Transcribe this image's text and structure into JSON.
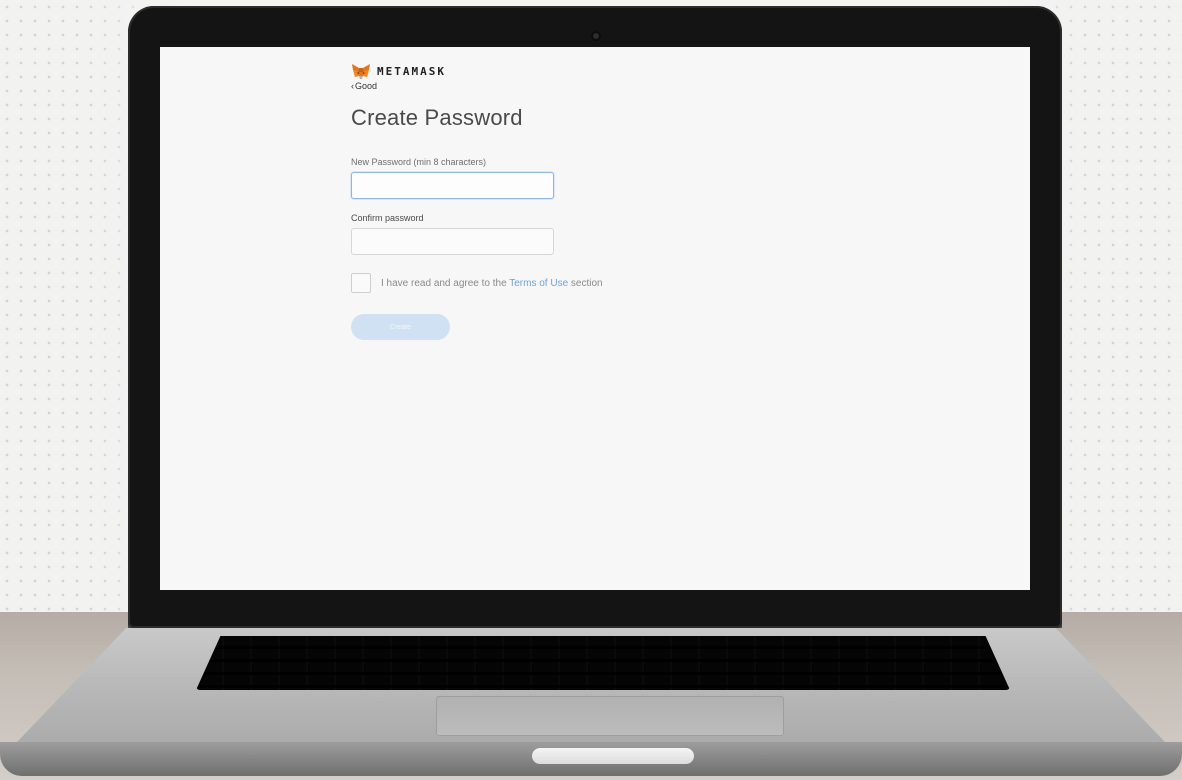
{
  "brand": {
    "name": "METAMASK",
    "icon": "metamask-fox-icon"
  },
  "nav": {
    "back_label": "Good",
    "back_icon": "chevron-left-icon"
  },
  "page": {
    "title": "Create Password"
  },
  "form": {
    "new_password": {
      "label": "New Password (min 8 characters)",
      "value": "",
      "placeholder": ""
    },
    "confirm_password": {
      "label": "Confirm password",
      "value": "",
      "placeholder": ""
    },
    "terms": {
      "checked": false,
      "prefix": "I have read and agree to the ",
      "link": "Terms of Use",
      "suffix": " section"
    },
    "submit_label": "Create"
  },
  "colors": {
    "link": "#6fa2d8",
    "button_disabled": "#cfe1f3",
    "input_focus_border": "#8fb6e4"
  }
}
